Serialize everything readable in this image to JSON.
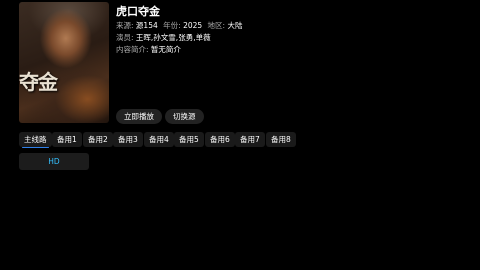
{
  "poster": {
    "title_text": "夺金"
  },
  "detail": {
    "title": "虎口夺金",
    "source_label": "来源:",
    "source_value": "源154",
    "year_label": "年份:",
    "year_value": "2025",
    "region_label": "地区:",
    "region_value": "大陆",
    "actors_label": "演员:",
    "actors_value": "王晖,孙文雪,张勇,单薇",
    "intro_label": "内容简介:",
    "intro_value": "暂无简介"
  },
  "actions": {
    "play_label": "立即播放",
    "switch_label": "切换源"
  },
  "sources": [
    "主线路",
    "备用1",
    "备用2",
    "备用3",
    "备用4",
    "备用5",
    "备用6",
    "备用7",
    "备用8"
  ],
  "episodes": [
    "HD"
  ],
  "colors": {
    "accent": "#2f7fe8",
    "episode_text": "#35c0ff"
  }
}
